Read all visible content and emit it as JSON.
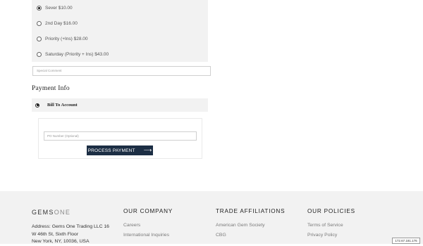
{
  "shipping": {
    "options": [
      {
        "label": "Sever $10.00",
        "checked": true
      },
      {
        "label": "2nd Day $16.00",
        "checked": false
      },
      {
        "label": "Priority (+Ins) $28.00",
        "checked": false
      },
      {
        "label": "Saturday (Priority + Ins) $43.00",
        "checked": false
      }
    ],
    "comment_placeholder": "Special Comment"
  },
  "payment": {
    "title": "Payment Info",
    "method_label": "Bill To Account",
    "po_placeholder": "PO Number (Optional)",
    "process_label": "PROCESS PAYMENT",
    "process_icon": "arrow-right-icon"
  },
  "footer": {
    "logo_part1": "GEMS",
    "logo_part2": "ONE",
    "address_line1": "Address: Gems One Trading LLC 16",
    "address_line2": "W 46th St, Sixth Floor",
    "address_line3": "New York, NY, 10036, USA",
    "columns": [
      {
        "heading": "OUR COMPANY",
        "links": [
          "Careers",
          "International Inquiries"
        ]
      },
      {
        "heading": "TRADE AFFILIATIONS",
        "links": [
          "American Gem Society",
          "CBG"
        ]
      },
      {
        "heading": "OUR POLICIES",
        "links": [
          "Terms of Service",
          "Privacy Policy"
        ]
      }
    ]
  },
  "ip_badge": "172.67.181.176"
}
